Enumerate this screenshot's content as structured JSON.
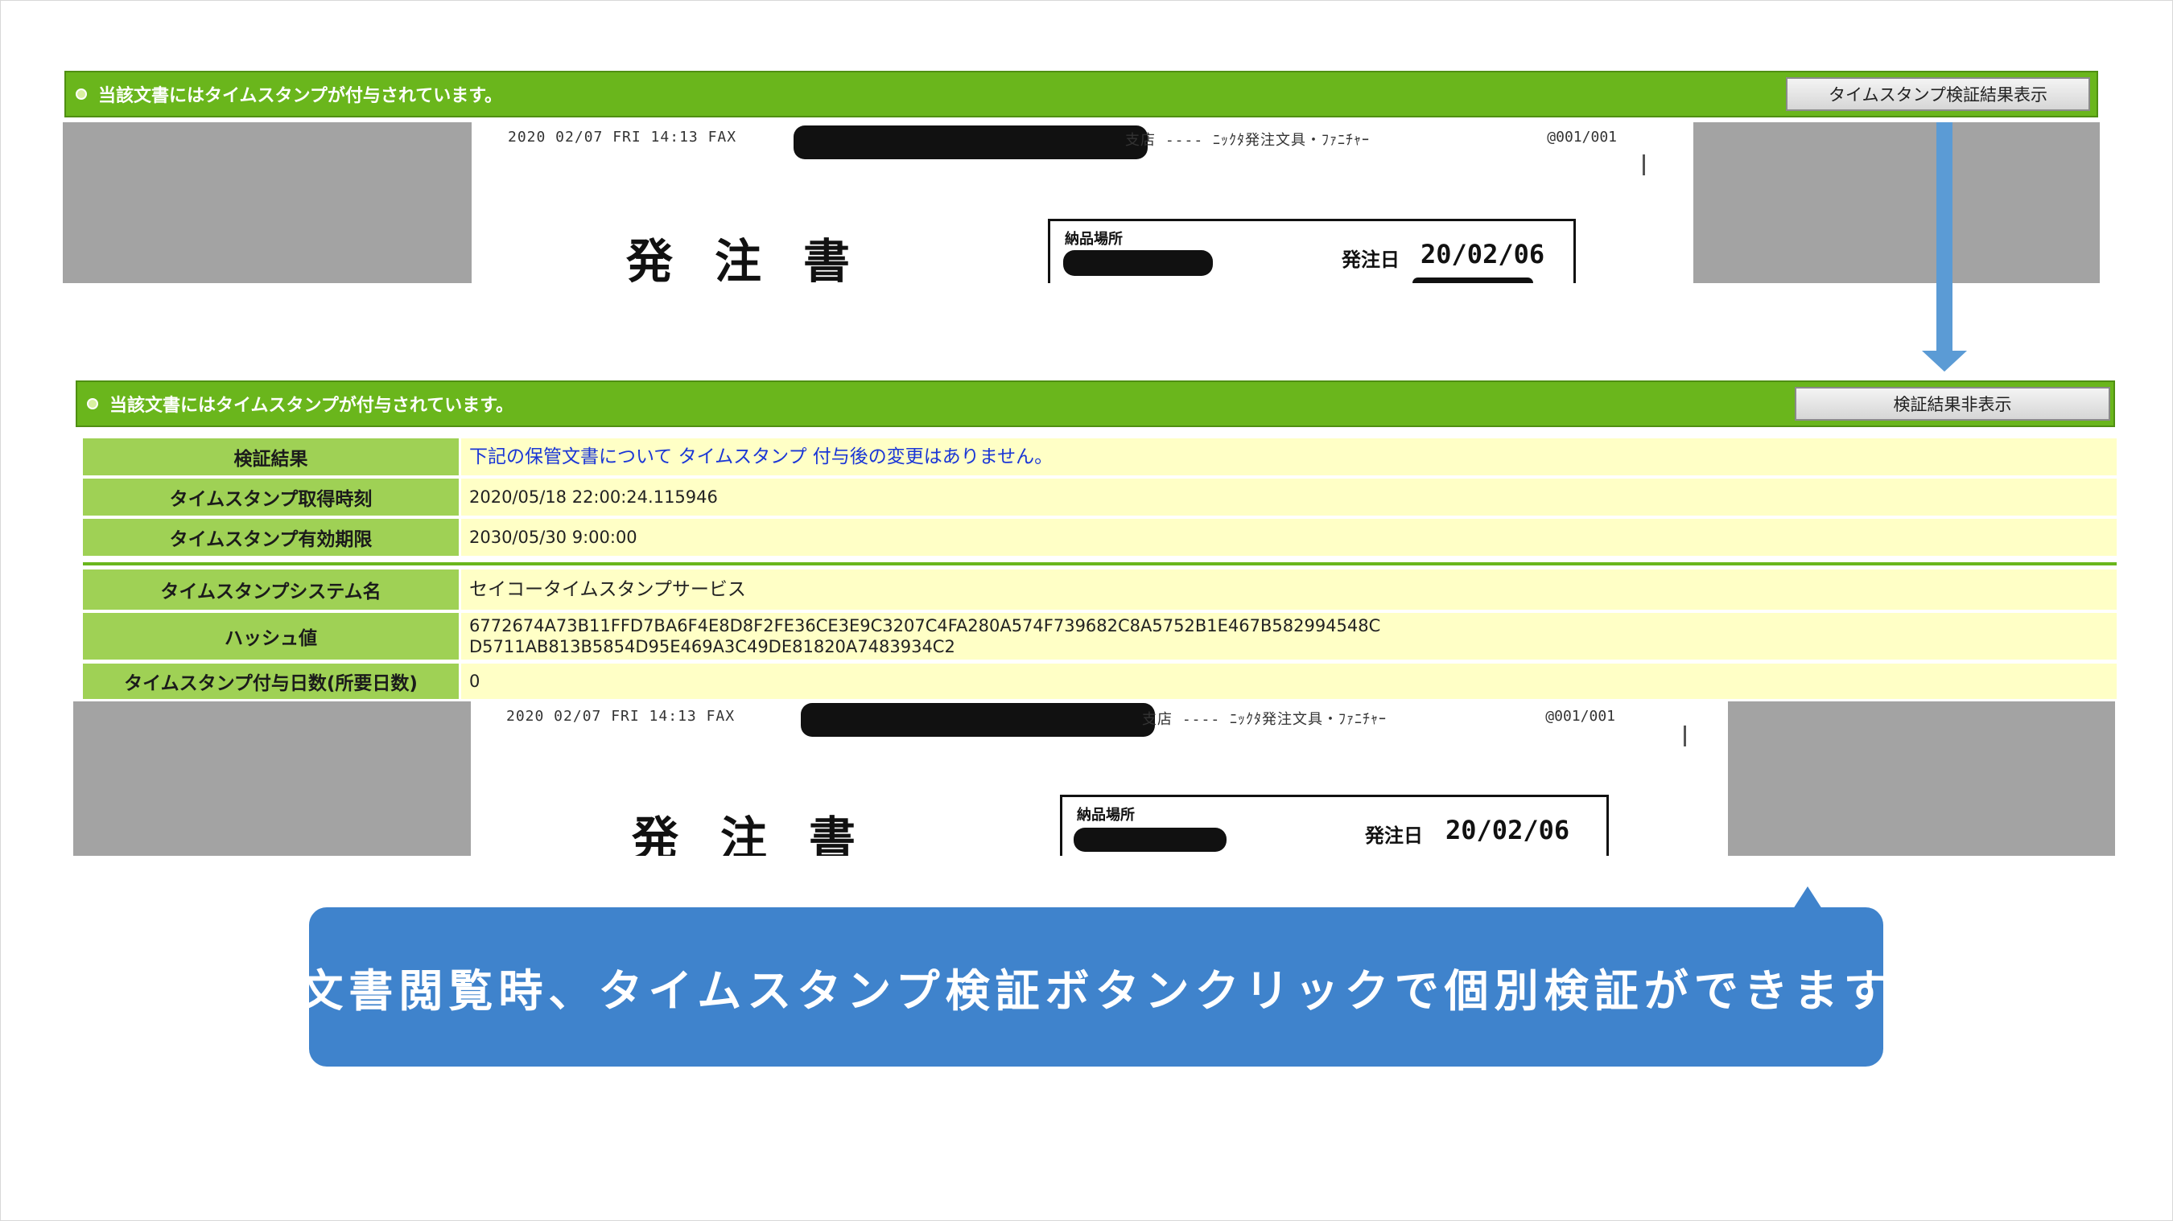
{
  "top_panel": {
    "status_text": "当該文書にはタイムスタンプが付与されています。",
    "verify_button_label": "タイムスタンプ検証結果表示"
  },
  "bottom_panel": {
    "status_text": "当該文書にはタイムスタンプが付与されています。",
    "hide_button_label": "検証結果非表示",
    "rows": [
      {
        "label": "検証結果",
        "value": "下記の保管文書について タイムスタンプ 付与後の変更はありません。"
      },
      {
        "label": "タイムスタンプ取得時刻",
        "value": "2020/05/18 22:00:24.115946"
      },
      {
        "label": "タイムスタンプ有効期限",
        "value": "2030/05/30 9:00:00"
      },
      {
        "label": "タイムスタンプシステム名",
        "value": "セイコータイムスタンプサービス"
      },
      {
        "label": "ハッシュ値",
        "value_line1": "6772674A73B11FFD7BA6F4E8D8F2FE36CE3E9C3207C4FA280A574F739682C8A5752B1E467B582994548C",
        "value_line2": "D5711AB813B5854D95E469A3C49DE81820A7483934C2"
      },
      {
        "label": "タイムスタンプ付与日数(所要日数)",
        "value": "0"
      }
    ]
  },
  "document": {
    "fax_header": "2020 02/07 FRI 14:13  FAX",
    "fax_mid": "支店  ----  ﾆｯｸﾀ発注文具・ﾌｧﾆﾁｬｰ",
    "fax_page": "@001/001",
    "title": "発注書",
    "box_label": "納品場所",
    "order_date_label": "発注日",
    "order_date": "20/02/06"
  },
  "callout": {
    "text": "文書閲覧時、タイムスタンプ検証ボタンクリックで個別検証ができます"
  },
  "colors": {
    "bar_green": "#6ab61c",
    "label_green": "#9fd155",
    "value_yellow": "#ffffc6",
    "arrow_blue": "#5b9bd5",
    "callout_blue": "#3f83cc"
  }
}
